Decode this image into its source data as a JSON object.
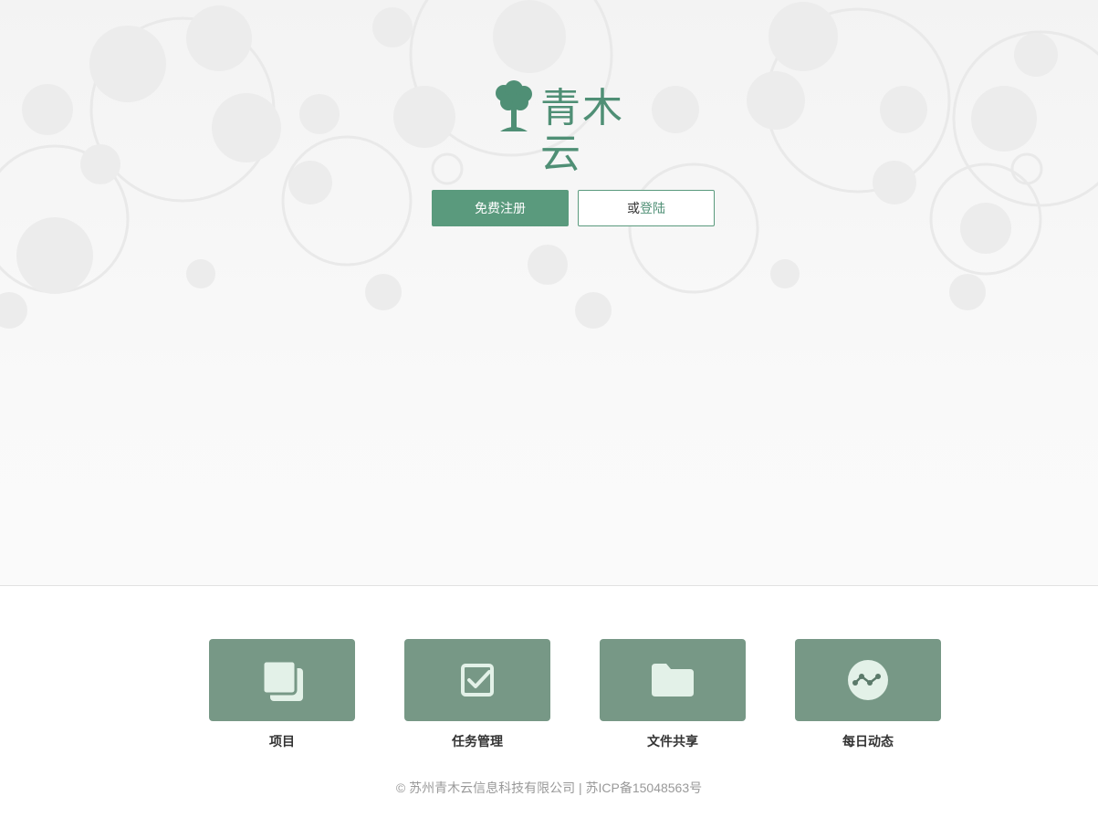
{
  "brand": {
    "name": "青木云",
    "accent": "#5a9a7d",
    "card_color": "#779886"
  },
  "actions": {
    "register_label": "免费注册",
    "login_prefix": "或",
    "login_link": "登陆"
  },
  "features": [
    {
      "label": "项目",
      "icon": "stacked-pages-icon"
    },
    {
      "label": "任务管理",
      "icon": "checkbox-icon"
    },
    {
      "label": "文件共享",
      "icon": "folder-icon"
    },
    {
      "label": "每日动态",
      "icon": "activity-icon"
    }
  ],
  "footer": {
    "text": "© 苏州青木云信息科技有限公司 | 苏ICP备15048563号"
  }
}
